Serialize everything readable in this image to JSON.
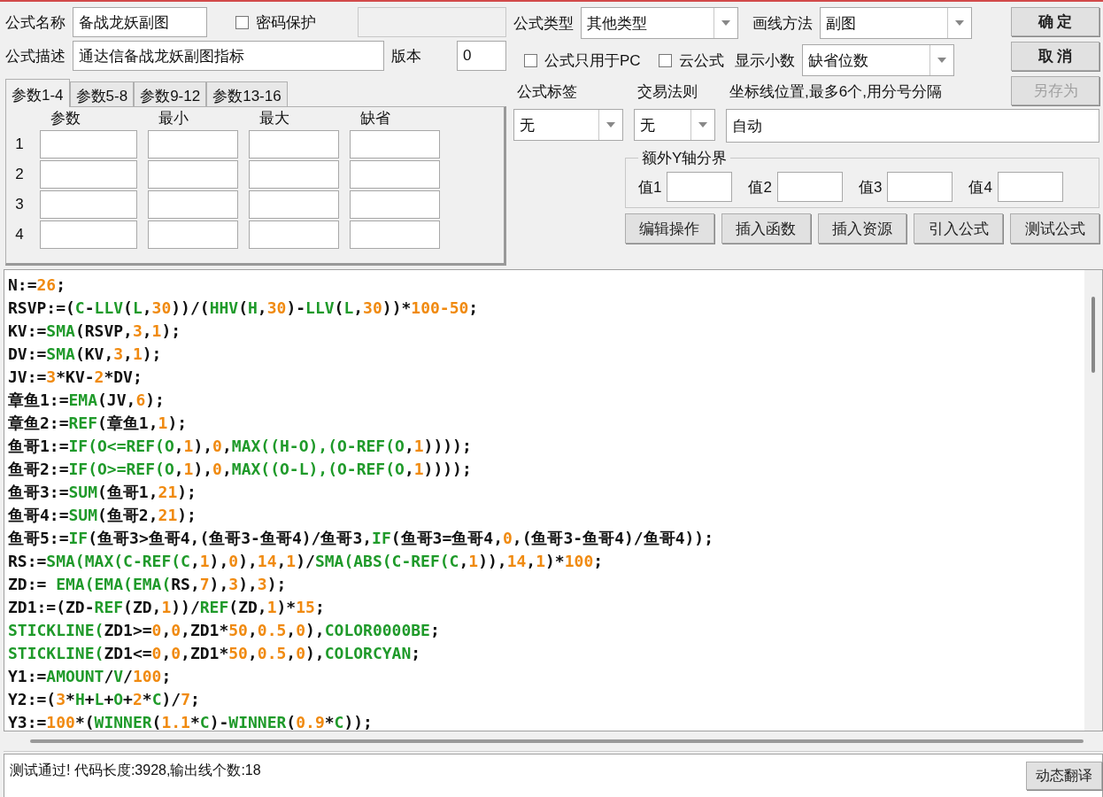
{
  "formula": {
    "name_label": "公式名称",
    "name": "备战龙妖副图",
    "password": {
      "label": "密码保护",
      "checked": false
    },
    "description_label": "公式描述",
    "description": "通达信备战龙妖副图指标",
    "version_label": "版本",
    "version": "0",
    "type_label": "公式类型",
    "type": "其他类型",
    "draw_label": "画线方法",
    "draw": "副图",
    "pc_only": {
      "label": "公式只用于PC",
      "checked": false
    },
    "cloud": {
      "label": "云公式",
      "checked": false
    },
    "decimals_label": "显示小数",
    "decimals": "缺省位数"
  },
  "buttons": [
    {
      "label": "确 定",
      "disabled": false
    },
    {
      "label": "取 消",
      "disabled": false
    },
    {
      "label": "另存为",
      "disabled": true
    }
  ],
  "param_tabs": [
    {
      "label": "参数1-4",
      "selected": true
    },
    {
      "label": "参数5-8",
      "selected": false
    },
    {
      "label": "参数9-12",
      "selected": false
    },
    {
      "label": "参数13-16",
      "selected": false
    }
  ],
  "param_columns": [
    "参数",
    "最小",
    "最大",
    "缺省"
  ],
  "param_rows": [
    "1",
    "2",
    "3",
    "4"
  ],
  "tag": {
    "label": "公式标签",
    "value": "无"
  },
  "trade_rule": {
    "label": "交易法则",
    "value": "无"
  },
  "axis_lines": {
    "label": "坐标线位置,最多6个,用分号分隔",
    "value": "自动"
  },
  "y_bounds": {
    "title": "额外Y轴分界",
    "labels": [
      "值1",
      "值2",
      "值3",
      "值4"
    ]
  },
  "action_buttons": [
    "编辑操作",
    "插入函数",
    "插入资源",
    "引入公式",
    "测试公式"
  ],
  "code_lines": [
    [
      {
        "text": "N:=",
        "kind": "plain"
      },
      {
        "text": "26",
        "kind": "number"
      },
      {
        "text": ";",
        "kind": "plain"
      }
    ],
    [
      {
        "text": "RSVP:=(",
        "kind": "plain"
      },
      {
        "text": "C",
        "kind": "func"
      },
      {
        "text": "-",
        "kind": "plain"
      },
      {
        "text": "LLV",
        "kind": "func"
      },
      {
        "text": "(",
        "kind": "plain"
      },
      {
        "text": "L",
        "kind": "func"
      },
      {
        "text": ",",
        "kind": "plain"
      },
      {
        "text": "30",
        "kind": "number"
      },
      {
        "text": "))/(",
        "kind": "plain"
      },
      {
        "text": "HHV",
        "kind": "func"
      },
      {
        "text": "(",
        "kind": "plain"
      },
      {
        "text": "H",
        "kind": "func"
      },
      {
        "text": ",",
        "kind": "plain"
      },
      {
        "text": "30",
        "kind": "number"
      },
      {
        "text": ")-",
        "kind": "plain"
      },
      {
        "text": "LLV",
        "kind": "func"
      },
      {
        "text": "(",
        "kind": "plain"
      },
      {
        "text": "L",
        "kind": "func"
      },
      {
        "text": ",",
        "kind": "plain"
      },
      {
        "text": "30",
        "kind": "number"
      },
      {
        "text": "))*",
        "kind": "plain"
      },
      {
        "text": "100-50",
        "kind": "number"
      },
      {
        "text": ";",
        "kind": "plain"
      }
    ],
    [
      {
        "text": "KV:=",
        "kind": "plain"
      },
      {
        "text": "SMA",
        "kind": "func"
      },
      {
        "text": "(RSVP,",
        "kind": "plain"
      },
      {
        "text": "3",
        "kind": "number"
      },
      {
        "text": ",",
        "kind": "plain"
      },
      {
        "text": "1",
        "kind": "number"
      },
      {
        "text": ");",
        "kind": "plain"
      }
    ],
    [
      {
        "text": "DV:=",
        "kind": "plain"
      },
      {
        "text": "SMA",
        "kind": "func"
      },
      {
        "text": "(KV,",
        "kind": "plain"
      },
      {
        "text": "3",
        "kind": "number"
      },
      {
        "text": ",",
        "kind": "plain"
      },
      {
        "text": "1",
        "kind": "number"
      },
      {
        "text": ");",
        "kind": "plain"
      }
    ],
    [
      {
        "text": "JV:=",
        "kind": "plain"
      },
      {
        "text": "3",
        "kind": "number"
      },
      {
        "text": "*KV-",
        "kind": "plain"
      },
      {
        "text": "2",
        "kind": "number"
      },
      {
        "text": "*DV;",
        "kind": "plain"
      }
    ],
    [
      {
        "text": "章鱼1:=",
        "kind": "plain"
      },
      {
        "text": "EMA",
        "kind": "func"
      },
      {
        "text": "(JV,",
        "kind": "plain"
      },
      {
        "text": "6",
        "kind": "number"
      },
      {
        "text": ");",
        "kind": "plain"
      }
    ],
    [
      {
        "text": "章鱼2:=",
        "kind": "plain"
      },
      {
        "text": "REF",
        "kind": "func"
      },
      {
        "text": "(章鱼1,",
        "kind": "plain"
      },
      {
        "text": "1",
        "kind": "number"
      },
      {
        "text": ");",
        "kind": "plain"
      }
    ],
    [
      {
        "text": "鱼哥1:=",
        "kind": "plain"
      },
      {
        "text": "IF(O<=REF(O",
        "kind": "func"
      },
      {
        "text": ",",
        "kind": "plain"
      },
      {
        "text": "1",
        "kind": "number"
      },
      {
        "text": "),",
        "kind": "plain"
      },
      {
        "text": "0",
        "kind": "number"
      },
      {
        "text": ",",
        "kind": "plain"
      },
      {
        "text": "MAX((H-O),(O-REF(O",
        "kind": "func"
      },
      {
        "text": ",",
        "kind": "plain"
      },
      {
        "text": "1",
        "kind": "number"
      },
      {
        "text": "))));",
        "kind": "plain"
      }
    ],
    [
      {
        "text": "鱼哥2:=",
        "kind": "plain"
      },
      {
        "text": "IF(O>=REF(O",
        "kind": "func"
      },
      {
        "text": ",",
        "kind": "plain"
      },
      {
        "text": "1",
        "kind": "number"
      },
      {
        "text": "),",
        "kind": "plain"
      },
      {
        "text": "0",
        "kind": "number"
      },
      {
        "text": ",",
        "kind": "plain"
      },
      {
        "text": "MAX((O-L),(O-REF(O",
        "kind": "func"
      },
      {
        "text": ",",
        "kind": "plain"
      },
      {
        "text": "1",
        "kind": "number"
      },
      {
        "text": "))));",
        "kind": "plain"
      }
    ],
    [
      {
        "text": "鱼哥3:=",
        "kind": "plain"
      },
      {
        "text": "SUM",
        "kind": "func"
      },
      {
        "text": "(鱼哥1,",
        "kind": "plain"
      },
      {
        "text": "21",
        "kind": "number"
      },
      {
        "text": ");",
        "kind": "plain"
      }
    ],
    [
      {
        "text": "鱼哥4:=",
        "kind": "plain"
      },
      {
        "text": "SUM",
        "kind": "func"
      },
      {
        "text": "(鱼哥2,",
        "kind": "plain"
      },
      {
        "text": "21",
        "kind": "number"
      },
      {
        "text": ");",
        "kind": "plain"
      }
    ],
    [
      {
        "text": "鱼哥5:=",
        "kind": "plain"
      },
      {
        "text": "IF",
        "kind": "func"
      },
      {
        "text": "(鱼哥3>鱼哥4,(鱼哥3-鱼哥4)/鱼哥3,",
        "kind": "plain"
      },
      {
        "text": "IF",
        "kind": "func"
      },
      {
        "text": "(鱼哥3=鱼哥4,",
        "kind": "plain"
      },
      {
        "text": "0",
        "kind": "number"
      },
      {
        "text": ",(鱼哥3-鱼哥4)/鱼哥4));",
        "kind": "plain"
      }
    ],
    [
      {
        "text": "RS:=",
        "kind": "plain"
      },
      {
        "text": "SMA(MAX(C-REF(C",
        "kind": "func"
      },
      {
        "text": ",",
        "kind": "plain"
      },
      {
        "text": "1",
        "kind": "number"
      },
      {
        "text": "),",
        "kind": "plain"
      },
      {
        "text": "0",
        "kind": "number"
      },
      {
        "text": "),",
        "kind": "plain"
      },
      {
        "text": "14",
        "kind": "number"
      },
      {
        "text": ",",
        "kind": "plain"
      },
      {
        "text": "1",
        "kind": "number"
      },
      {
        "text": ")/",
        "kind": "plain"
      },
      {
        "text": "SMA(ABS(C-REF(C",
        "kind": "func"
      },
      {
        "text": ",",
        "kind": "plain"
      },
      {
        "text": "1",
        "kind": "number"
      },
      {
        "text": ")),",
        "kind": "plain"
      },
      {
        "text": "14",
        "kind": "number"
      },
      {
        "text": ",",
        "kind": "plain"
      },
      {
        "text": "1",
        "kind": "number"
      },
      {
        "text": ")*",
        "kind": "plain"
      },
      {
        "text": "100",
        "kind": "number"
      },
      {
        "text": ";",
        "kind": "plain"
      }
    ],
    [
      {
        "text": "ZD:= ",
        "kind": "plain"
      },
      {
        "text": "EMA(EMA(EMA(",
        "kind": "func"
      },
      {
        "text": "RS,",
        "kind": "plain"
      },
      {
        "text": "7",
        "kind": "number"
      },
      {
        "text": "),",
        "kind": "plain"
      },
      {
        "text": "3",
        "kind": "number"
      },
      {
        "text": "),",
        "kind": "plain"
      },
      {
        "text": "3",
        "kind": "number"
      },
      {
        "text": ");",
        "kind": "plain"
      }
    ],
    [
      {
        "text": "ZD1:=(ZD-",
        "kind": "plain"
      },
      {
        "text": "REF",
        "kind": "func"
      },
      {
        "text": "(ZD,",
        "kind": "plain"
      },
      {
        "text": "1",
        "kind": "number"
      },
      {
        "text": "))/",
        "kind": "plain"
      },
      {
        "text": "REF",
        "kind": "func"
      },
      {
        "text": "(ZD,",
        "kind": "plain"
      },
      {
        "text": "1",
        "kind": "number"
      },
      {
        "text": ")*",
        "kind": "plain"
      },
      {
        "text": "15",
        "kind": "number"
      },
      {
        "text": ";",
        "kind": "plain"
      }
    ],
    [
      {
        "text": "STICKLINE(",
        "kind": "func"
      },
      {
        "text": "ZD1>=",
        "kind": "plain"
      },
      {
        "text": "0",
        "kind": "number"
      },
      {
        "text": ",",
        "kind": "plain"
      },
      {
        "text": "0",
        "kind": "number"
      },
      {
        "text": ",ZD1*",
        "kind": "plain"
      },
      {
        "text": "50",
        "kind": "number"
      },
      {
        "text": ",",
        "kind": "plain"
      },
      {
        "text": "0.5",
        "kind": "number"
      },
      {
        "text": ",",
        "kind": "plain"
      },
      {
        "text": "0",
        "kind": "number"
      },
      {
        "text": "),",
        "kind": "plain"
      },
      {
        "text": "COLOR0000BE",
        "kind": "func"
      },
      {
        "text": ";",
        "kind": "plain"
      }
    ],
    [
      {
        "text": "STICKLINE(",
        "kind": "func"
      },
      {
        "text": "ZD1<=",
        "kind": "plain"
      },
      {
        "text": "0",
        "kind": "number"
      },
      {
        "text": ",",
        "kind": "plain"
      },
      {
        "text": "0",
        "kind": "number"
      },
      {
        "text": ",ZD1*",
        "kind": "plain"
      },
      {
        "text": "50",
        "kind": "number"
      },
      {
        "text": ",",
        "kind": "plain"
      },
      {
        "text": "0.5",
        "kind": "number"
      },
      {
        "text": ",",
        "kind": "plain"
      },
      {
        "text": "0",
        "kind": "number"
      },
      {
        "text": "),",
        "kind": "plain"
      },
      {
        "text": "COLORCYAN",
        "kind": "func"
      },
      {
        "text": ";",
        "kind": "plain"
      }
    ],
    [
      {
        "text": "Y1:=",
        "kind": "plain"
      },
      {
        "text": "AMOUNT",
        "kind": "func"
      },
      {
        "text": "/",
        "kind": "plain"
      },
      {
        "text": "V",
        "kind": "func"
      },
      {
        "text": "/",
        "kind": "plain"
      },
      {
        "text": "100",
        "kind": "number"
      },
      {
        "text": ";",
        "kind": "plain"
      }
    ],
    [
      {
        "text": "Y2:=(",
        "kind": "plain"
      },
      {
        "text": "3",
        "kind": "number"
      },
      {
        "text": "*",
        "kind": "plain"
      },
      {
        "text": "H",
        "kind": "func"
      },
      {
        "text": "+",
        "kind": "plain"
      },
      {
        "text": "L",
        "kind": "func"
      },
      {
        "text": "+",
        "kind": "plain"
      },
      {
        "text": "O",
        "kind": "func"
      },
      {
        "text": "+",
        "kind": "plain"
      },
      {
        "text": "2",
        "kind": "number"
      },
      {
        "text": "*",
        "kind": "plain"
      },
      {
        "text": "C",
        "kind": "func"
      },
      {
        "text": ")/",
        "kind": "plain"
      },
      {
        "text": "7",
        "kind": "number"
      },
      {
        "text": ";",
        "kind": "plain"
      }
    ],
    [
      {
        "text": "Y3:=",
        "kind": "plain"
      },
      {
        "text": "100",
        "kind": "number"
      },
      {
        "text": "*(",
        "kind": "plain"
      },
      {
        "text": "WINNER",
        "kind": "func"
      },
      {
        "text": "(",
        "kind": "plain"
      },
      {
        "text": "1.1",
        "kind": "number"
      },
      {
        "text": "*",
        "kind": "plain"
      },
      {
        "text": "C",
        "kind": "func"
      },
      {
        "text": ")-",
        "kind": "plain"
      },
      {
        "text": "WINNER",
        "kind": "func"
      },
      {
        "text": "(",
        "kind": "plain"
      },
      {
        "text": "0.9",
        "kind": "number"
      },
      {
        "text": "*",
        "kind": "plain"
      },
      {
        "text": "C",
        "kind": "func"
      },
      {
        "text": "));",
        "kind": "plain"
      }
    ]
  ],
  "status": "测试通过! 代码长度:3928,输出线个数:18",
  "translate_button": "动态翻译"
}
